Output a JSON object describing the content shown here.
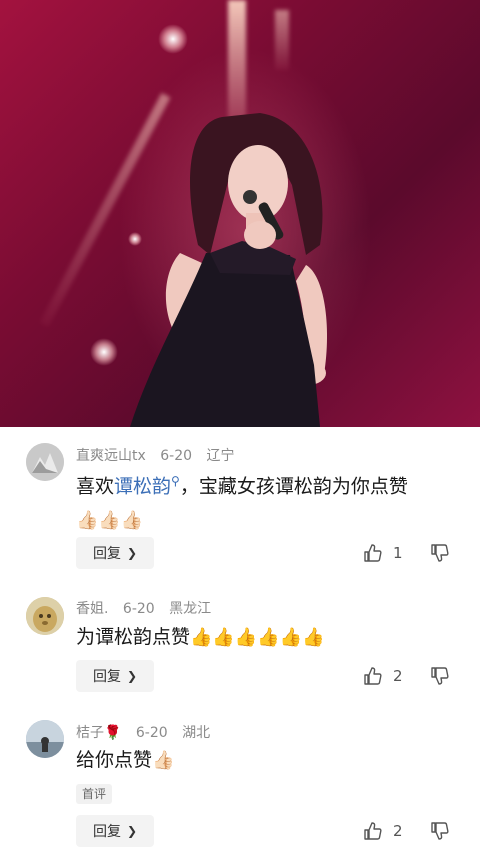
{
  "comments": [
    {
      "user": "直爽远山tx",
      "date": "6-20",
      "region": "辽宁",
      "text_prefix": "喜欢",
      "link": "谭松韵",
      "text_suffix": "，宝藏女孩谭松韵为你点赞",
      "emoji": "👍🏻👍🏻👍🏻",
      "reply_label": "回复",
      "likes": "1"
    },
    {
      "user": "香姐.",
      "date": "6-20",
      "region": "黑龙江",
      "text": "为谭松韵点赞",
      "emoji": "👍👍👍👍👍👍",
      "reply_label": "回复",
      "likes": "2"
    },
    {
      "user": "桔子🌹",
      "date": "6-20",
      "region": "湖北",
      "text": "给你点赞",
      "emoji": "👍🏻",
      "badge": "首评",
      "reply_label": "回复",
      "likes": "2"
    }
  ],
  "colors": {
    "link": "#3c6fb7",
    "meta": "#8a8a8a",
    "video_bg": "#7a0c33"
  }
}
